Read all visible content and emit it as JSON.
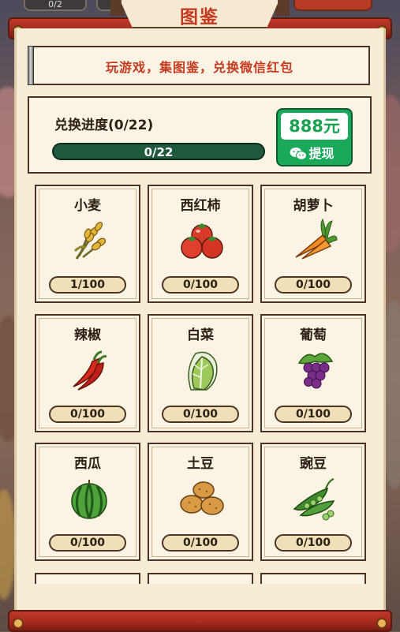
{
  "header": {
    "title": "图鉴",
    "left_chip": "0/2"
  },
  "banner": {
    "text": "玩游戏，集图鉴，兑换微信红包"
  },
  "progress": {
    "label": "兑换进度(0/22)",
    "bar_text": "0/22",
    "fraction": 0
  },
  "cash": {
    "amount": "888元",
    "withdraw_label": "提现"
  },
  "items": [
    {
      "name": "小麦",
      "count": "1/100",
      "icon": "wheat-icon"
    },
    {
      "name": "西红柿",
      "count": "0/100",
      "icon": "tomato-icon"
    },
    {
      "name": "胡萝卜",
      "count": "0/100",
      "icon": "carrot-icon"
    },
    {
      "name": "辣椒",
      "count": "0/100",
      "icon": "chili-icon"
    },
    {
      "name": "白菜",
      "count": "0/100",
      "icon": "cabbage-icon"
    },
    {
      "name": "葡萄",
      "count": "0/100",
      "icon": "grape-icon"
    },
    {
      "name": "西瓜",
      "count": "0/100",
      "icon": "watermelon-icon"
    },
    {
      "name": "土豆",
      "count": "0/100",
      "icon": "potato-icon"
    },
    {
      "name": "豌豆",
      "count": "0/100",
      "icon": "pea-icon"
    }
  ],
  "colors": {
    "accent_red": "#c23b20",
    "green": "#1aa85a",
    "paper": "#f7ecd6"
  }
}
